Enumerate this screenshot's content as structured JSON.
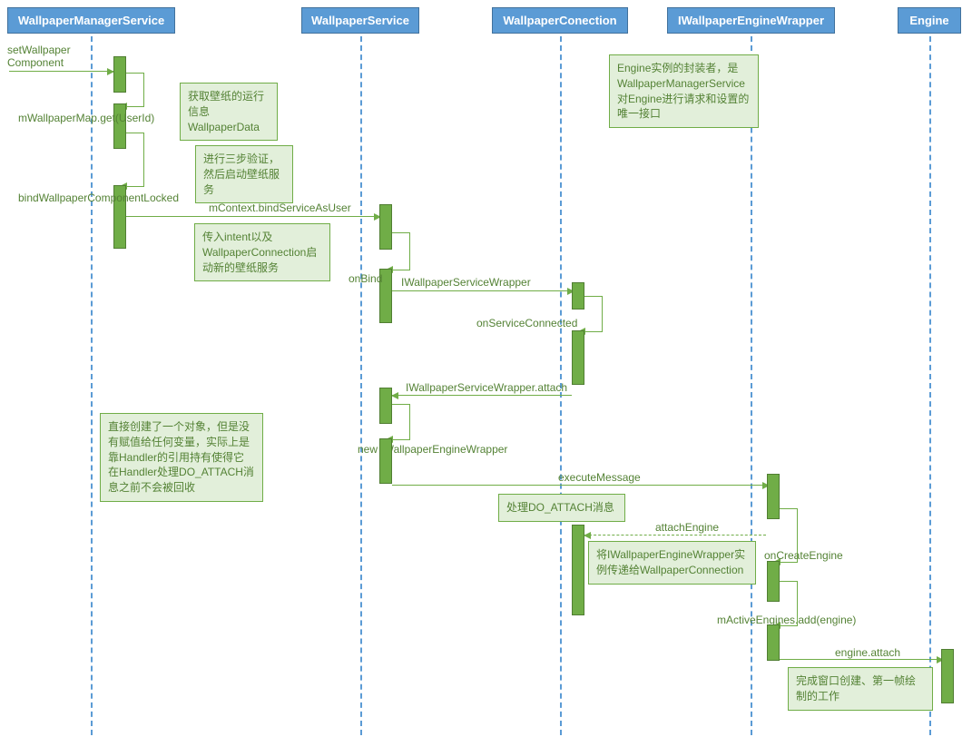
{
  "participants": {
    "p1": "WallpaperManagerService",
    "p2": "WallpaperService",
    "p3": "WallpaperConection",
    "p4": "IWallpaperEngineWrapper",
    "p5": "Engine"
  },
  "messages": {
    "setWallpaperComponent1": "setWallpaper",
    "setWallpaperComponent2": "Component",
    "mWallpaperMapGet": "mWallpaperMap.get(UserId)",
    "bindWallpaperComponentLocked": "bindWallpaperComponentLocked",
    "mContextBind": "mContext.bindServiceAsUser",
    "onBind": "onBind",
    "iWallpaperServiceWrapper": "IWallpaperServiceWrapper",
    "onServiceConnected": "onServiceConnected",
    "iWallpaperServiceWrapperAttach": "IWallpaperServiceWrapper.attach",
    "newIWallpaperEngineWrapper": "new IWallpaperEngineWrapper",
    "executeMessage": "executeMessage",
    "attachEngine": "attachEngine",
    "onCreateEngine": "onCreateEngine",
    "mActiveEnginesAdd": "mActiveEngines.add(engine)",
    "engineAttach": "engine.attach"
  },
  "notes": {
    "n1": "获取壁纸的运行信息WallpaperData",
    "n2": "进行三步验证，然后启动壁纸服务",
    "n3": "传入intent以及WallpaperConnection启动新的壁纸服务",
    "n4": "Engine实例的封装者，是WallpaperManagerService对Engine进行请求和设置的唯一接口",
    "n5": "直接创建了一个对象，但是没有赋值给任何变量，实际上是靠Handler的引用持有使得它在Handler处理DO_ATTACH消息之前不会被回收",
    "n6": "处理DO_ATTACH消息",
    "n7": "将IWallpaperEngineWrapper实例传递给WallpaperConnection",
    "n8": "完成窗口创建、第一帧绘制的工作"
  }
}
